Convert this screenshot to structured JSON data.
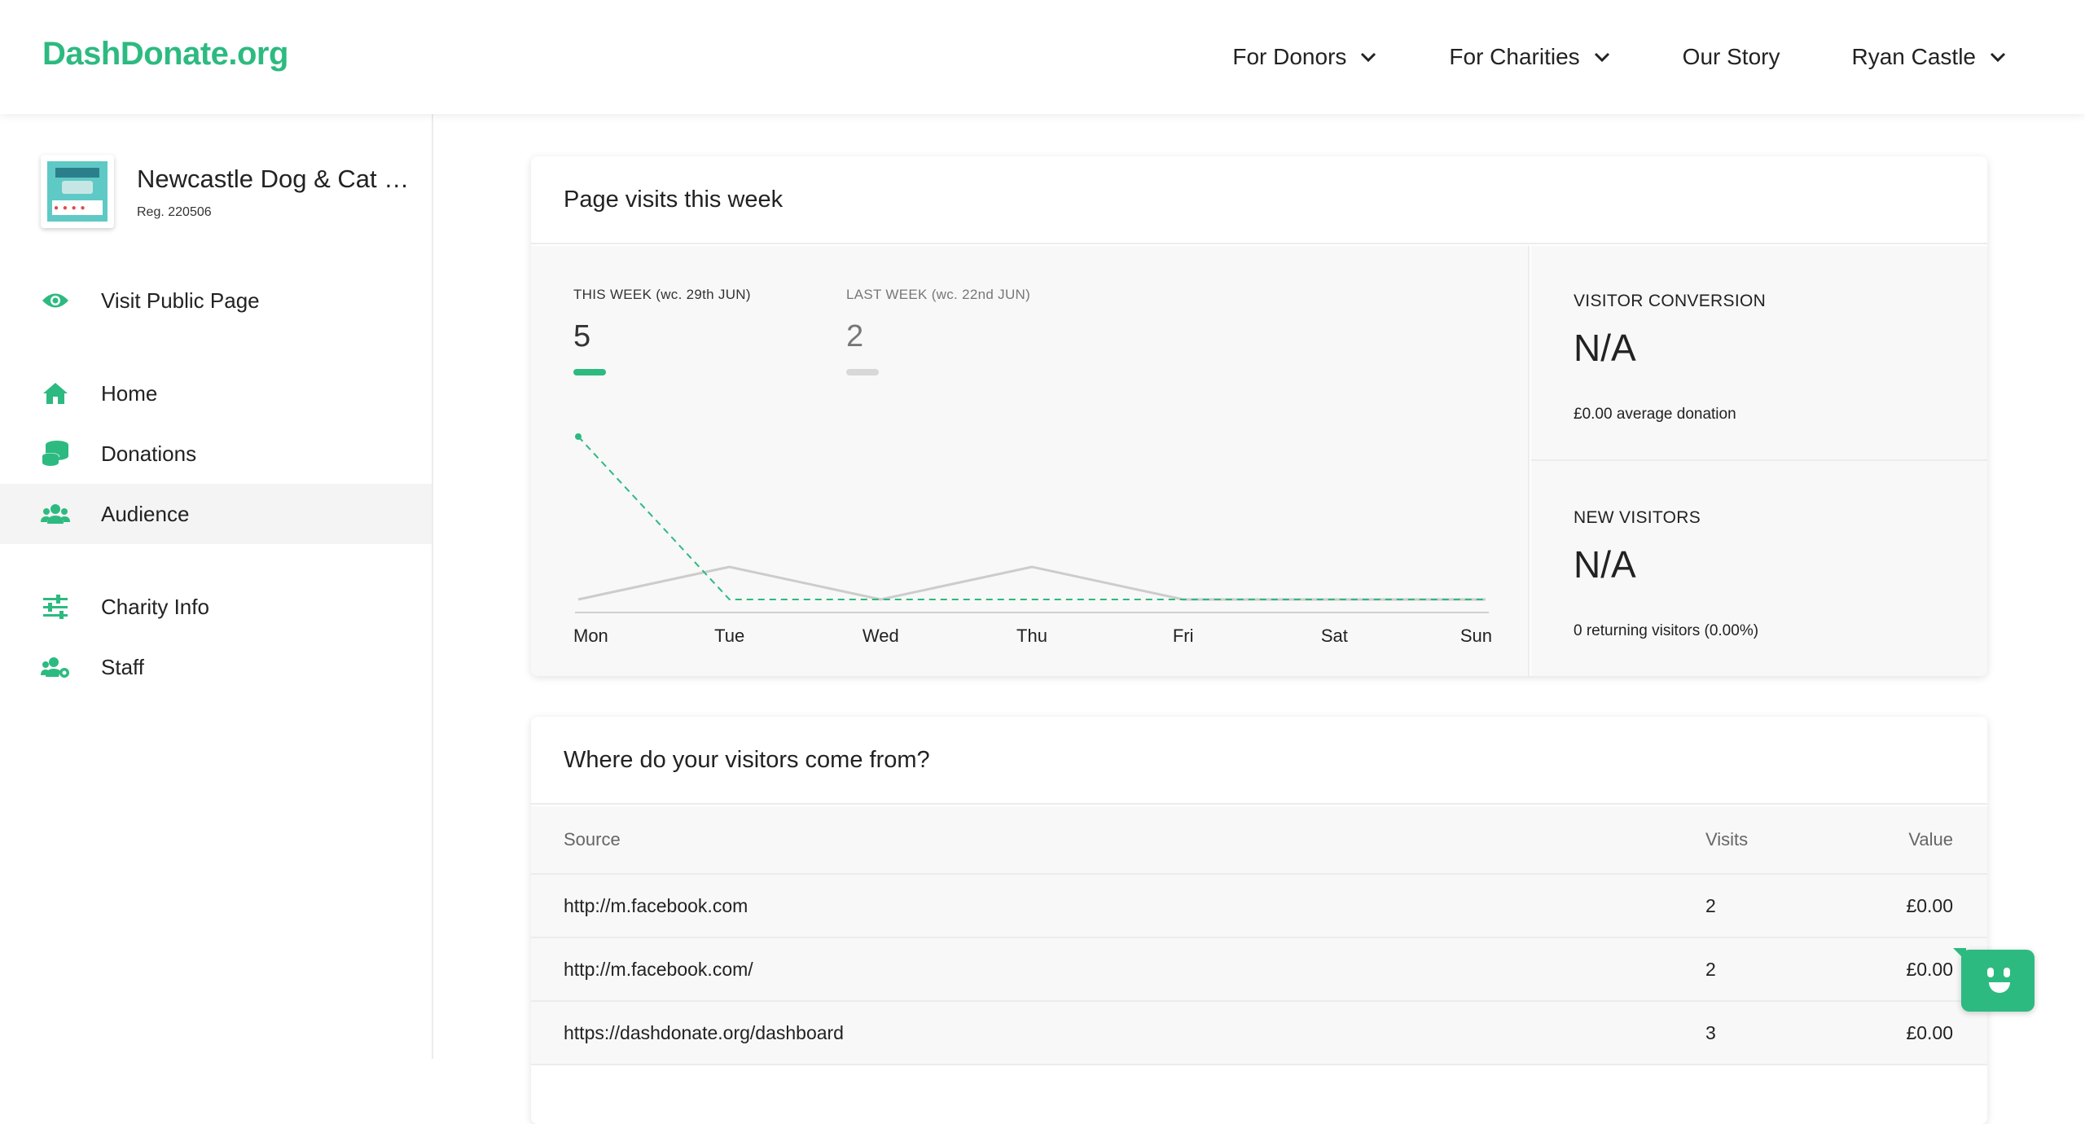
{
  "brand": {
    "logo_text": "DashDonate.org",
    "accent": "#2dba80"
  },
  "nav": {
    "items": [
      {
        "label": "For Donors",
        "has_dropdown": true
      },
      {
        "label": "For Charities",
        "has_dropdown": true
      },
      {
        "label": "Our Story",
        "has_dropdown": false
      },
      {
        "label": "Ryan Castle",
        "has_dropdown": true
      }
    ]
  },
  "sidebar": {
    "charity_name": "Newcastle Dog & Cat Shelter",
    "charity_reg": "Reg. 220506",
    "links": [
      {
        "label": "Visit Public Page",
        "icon": "eye-icon"
      },
      {
        "label": "Home",
        "icon": "home-icon"
      },
      {
        "label": "Donations",
        "icon": "coins-icon"
      },
      {
        "label": "Audience",
        "icon": "users-icon",
        "active": true
      },
      {
        "label": "Charity Info",
        "icon": "sliders-icon"
      },
      {
        "label": "Staff",
        "icon": "users-cog-icon"
      }
    ]
  },
  "visits_card": {
    "title": "Page visits this week",
    "this_week_label": "THIS WEEK (wc. 29th JUN)",
    "this_week_value": "5",
    "last_week_label": "LAST WEEK (wc. 22nd JUN)",
    "last_week_value": "2",
    "this_week_color": "#2dba80",
    "last_week_color": "#d0d0d0",
    "conversion_label": "VISITOR CONVERSION",
    "conversion_value": "N/A",
    "conversion_sub": "£0.00 average donation",
    "new_visitors_label": "NEW VISITORS",
    "new_visitors_value": "N/A",
    "new_visitors_sub": "0 returning visitors (0.00%)"
  },
  "chart_data": {
    "type": "line",
    "categories": [
      "Mon",
      "Tue",
      "Wed",
      "Thu",
      "Fri",
      "Sat",
      "Sun"
    ],
    "series": [
      {
        "name": "THIS WEEK (wc. 29th JUN)",
        "values": [
          5,
          0,
          0,
          0,
          0,
          0,
          0
        ],
        "color": "#2dba80",
        "style": "dashed"
      },
      {
        "name": "LAST WEEK (wc. 22nd JUN)",
        "values": [
          0,
          1,
          0,
          1,
          0,
          0,
          0
        ],
        "color": "#cccccc",
        "style": "solid"
      }
    ],
    "ylim": [
      0,
      5
    ],
    "grid": false
  },
  "sources_card": {
    "title": "Where do your visitors come from?",
    "headers": {
      "source": "Source",
      "visits": "Visits",
      "value": "Value"
    },
    "rows": [
      {
        "source": "http://m.facebook.com",
        "visits": "2",
        "value": "£0.00"
      },
      {
        "source": "http://m.facebook.com/",
        "visits": "2",
        "value": "£0.00"
      },
      {
        "source": "https://dashdonate.org/dashboard",
        "visits": "3",
        "value": "£0.00"
      }
    ]
  }
}
